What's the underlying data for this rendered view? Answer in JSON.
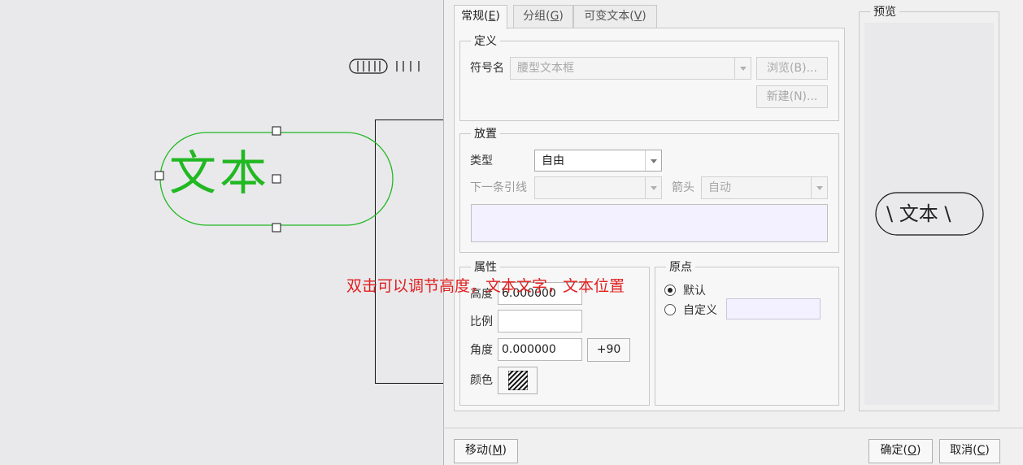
{
  "canvas": {
    "symbol_text": "文本",
    "annotation": "双击可以调节高度，文本文字，文本位置"
  },
  "tabs": [
    {
      "label": "常规(",
      "key": "E",
      "end": ")"
    },
    {
      "label": "分组(",
      "key": "G",
      "end": ")"
    },
    {
      "label": "可变文本(",
      "key": "V",
      "end": ")"
    }
  ],
  "definition": {
    "legend": "定义",
    "symbol_name_label": "符号名",
    "symbol_name_value": "腰型文本框",
    "browse_button": "浏览(B)...",
    "new_button": "新建(N)..."
  },
  "placement": {
    "legend": "放置",
    "type_label": "类型",
    "type_value": "自由",
    "next_leader_label": "下一条引线",
    "next_leader_value": "",
    "arrow_label": "箭头",
    "arrow_value": "自动"
  },
  "properties": {
    "legend": "属性",
    "height_label": "高度",
    "height_value": "6.000000",
    "scale_label": "比例",
    "scale_value": "",
    "angle_label": "角度",
    "angle_value": "0.000000",
    "rotate_button": "+90",
    "color_label": "颜色"
  },
  "origin": {
    "legend": "原点",
    "default_label": "默认",
    "custom_label": "自定义",
    "custom_value": "",
    "selected": "default"
  },
  "preview": {
    "legend": "预览",
    "symbol_text": "\\ 文本 \\"
  },
  "footer": {
    "move_label": "移动(",
    "move_key": "M",
    "ok_label": "确定(",
    "ok_key": "O",
    "cancel_label": "取消(",
    "cancel_key": "C",
    "close_paren": ")"
  },
  "colors": {
    "selection_green": "#22b822",
    "annotation_red": "#e02020",
    "dialog_bg": "#f0f0f0",
    "canvas_bg": "#e9e9ec"
  }
}
